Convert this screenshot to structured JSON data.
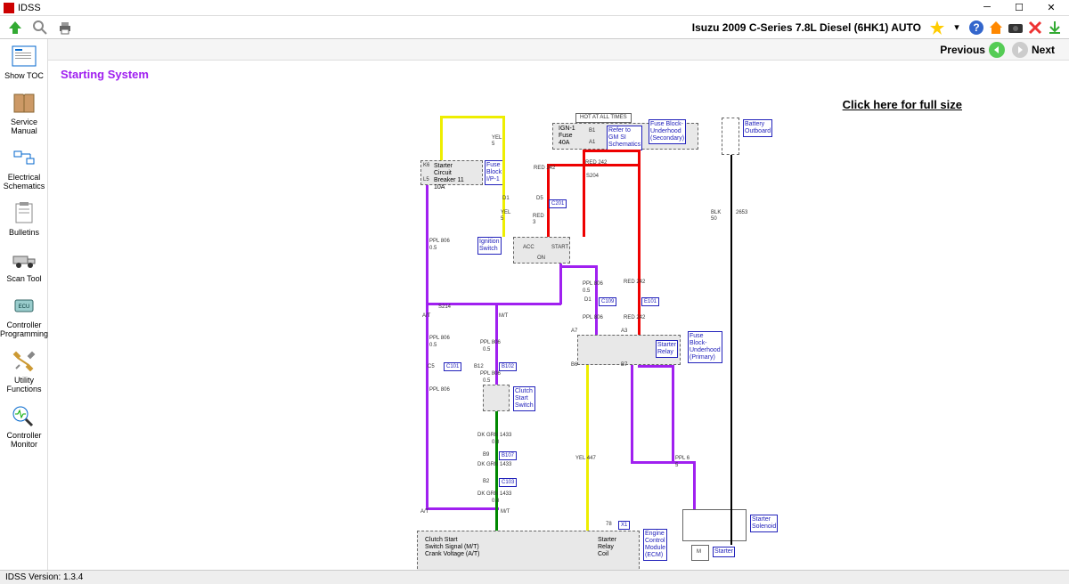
{
  "app": {
    "title": "IDSS",
    "version_label": "IDSS Version: 1.3.4"
  },
  "toolbar": {
    "vehicle": "Isuzu 2009 C-Series 7.8L Diesel (6HK1) AUTO"
  },
  "nav": {
    "prev_label": "Previous",
    "next_label": "Next"
  },
  "sidebar": {
    "items": [
      {
        "label": "Show TOC"
      },
      {
        "label": "Service Manual"
      },
      {
        "label": "Electrical Schematics"
      },
      {
        "label": "Bulletins"
      },
      {
        "label": "Scan Tool"
      },
      {
        "label": "Controller Programming"
      },
      {
        "label": "Utility Functions"
      },
      {
        "label": "Controller Monitor"
      }
    ]
  },
  "page": {
    "title": "Starting System",
    "full_size_link": "Click here for full size"
  },
  "diagram": {
    "hot_label": "HOT AT ALL TIMES",
    "boxes": {
      "ign_fuse": "IGN-1\nFuse\n40A",
      "gm_si": "Refer to\nGM SI\nSchematics",
      "fuse_sec": "Fuse Block-\nUnderhood\n(Secondary)",
      "battery": "Battery\nOutboard",
      "starter_cb": "Starter\nCircuit\nBreaker 11\n10A",
      "fuse_ip": "Fuse\nBlock\nI/P-1",
      "ign_sw": "Ignition\nSwitch",
      "ign_sw_acc": "ACC",
      "ign_sw_start": "START",
      "ign_sw_on": "ON",
      "starter_relay": "Starter\nRelay",
      "fuse_pri": "Fuse\nBlock-\nUnderhood\n(Primary)",
      "clutch_sw": "Clutch\nStart\nSwitch",
      "starter_solenoid": "Starter\nSolenoid",
      "starter": "Starter",
      "ecm": "Engine\nControl\nModule\n(ECM)",
      "clutch_signal": "Clutch Start\nSwitch Signal (M/T)\nCrank Voltage (A/T)",
      "starter_relay_coil": "Starter\nRelay\nCoil"
    },
    "wires": {
      "yel5": "YEL\n5",
      "red242": "RED  242",
      "red3": "RED\n3",
      "ppl806": "PPL  806",
      "ppl05": "0.5",
      "blk50": "BLK\n50",
      "w2653": "2653",
      "dkgrn1433": "DK GRN  1433",
      "dkgrn08": "0.8",
      "yel447": "YEL  447",
      "ppl6": "PPL  6",
      "ppl5": "5",
      "s204": "S204",
      "s214": "S214",
      "at": "A/T",
      "mt": "M/T",
      "d1": "D1",
      "d5": "D5",
      "a3": "A3",
      "a7": "A7",
      "b6": "B6",
      "b7": "B7",
      "b1": "B1",
      "a1": "A1",
      "k6": "K6",
      "l5": "L5",
      "c5": "C5",
      "b12": "B12",
      "b9": "B9",
      "b2": "B2",
      "pin78": "78"
    },
    "connectors": {
      "c201": "C201",
      "c109": "C109",
      "e101": "E101",
      "c101": "C101",
      "b102": "B102",
      "b107": "B107",
      "c103": "C103",
      "x1": "X1",
      "m": "M"
    }
  }
}
